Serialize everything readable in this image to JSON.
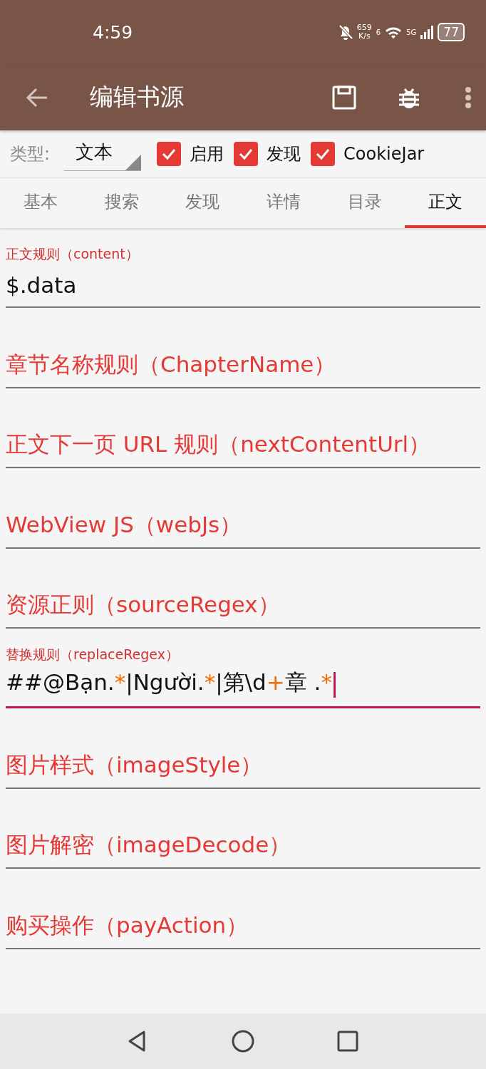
{
  "status_bar": {
    "time": "4:59",
    "net_speed": "659",
    "net_unit": "K/s",
    "wifi_badge": "6",
    "network": "5G",
    "battery": "77"
  },
  "toolbar": {
    "title": "编辑书源"
  },
  "options": {
    "type_label": "类型:",
    "type_value": "文本",
    "checkboxes": [
      {
        "label": "启用",
        "checked": true
      },
      {
        "label": "发现",
        "checked": true
      },
      {
        "label": "CookieJar",
        "checked": true
      }
    ]
  },
  "tabs": [
    {
      "label": "基本",
      "selected": false
    },
    {
      "label": "搜索",
      "selected": false
    },
    {
      "label": "发现",
      "selected": false
    },
    {
      "label": "详情",
      "selected": false
    },
    {
      "label": "目录",
      "selected": false
    },
    {
      "label": "正文",
      "selected": true
    }
  ],
  "fields": [
    {
      "label": "正文规则（content）",
      "value": [
        {
          "text": "$.data",
          "kind": "literal"
        }
      ],
      "focused": false
    },
    {
      "placeholder": "章节名称规则（ChapterName）",
      "focused": false
    },
    {
      "placeholder": "正文下一页 URL 规则（nextContentUrl）",
      "focused": false
    },
    {
      "placeholder": "WebView JS（webJs）",
      "focused": false
    },
    {
      "placeholder": "资源正则（sourceRegex）",
      "focused": false
    },
    {
      "label": "替换规则（replaceRegex）",
      "value": [
        {
          "text": "##@Bạn.",
          "kind": "literal"
        },
        {
          "text": "*",
          "kind": "quantifier"
        },
        {
          "text": "|Người.",
          "kind": "literal"
        },
        {
          "text": "*",
          "kind": "quantifier"
        },
        {
          "text": "|第\\d",
          "kind": "literal"
        },
        {
          "text": "+",
          "kind": "quantifier"
        },
        {
          "text": "章 .",
          "kind": "literal"
        },
        {
          "text": "*",
          "kind": "quantifier"
        }
      ],
      "focused": true
    },
    {
      "placeholder": "图片样式（imageStyle）",
      "focused": false
    },
    {
      "placeholder": "图片解密（imageDecode）",
      "focused": false
    },
    {
      "placeholder": "购买操作（payAction）",
      "focused": false
    }
  ]
}
